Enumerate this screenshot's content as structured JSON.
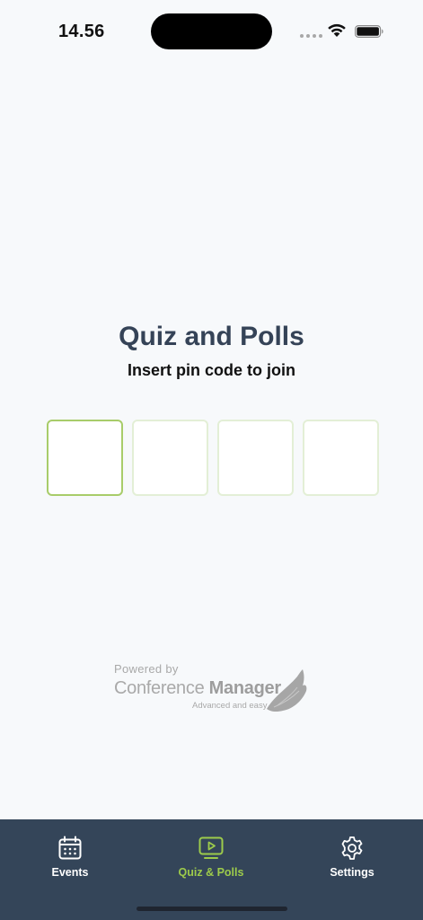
{
  "status_bar": {
    "time": "14.56"
  },
  "main": {
    "title": "Quiz and Polls",
    "subtitle": "Insert pin code to join",
    "pin_digits": [
      "",
      "",
      "",
      ""
    ]
  },
  "branding": {
    "powered_by": "Powered by",
    "brand_light": "Conference ",
    "brand_bold": "Manager",
    "tagline": "Advanced and easy"
  },
  "tab_bar": {
    "tabs": [
      {
        "label": "Events",
        "icon": "calendar-icon",
        "active": false
      },
      {
        "label": "Quiz & Polls",
        "icon": "monitor-play-icon",
        "active": true
      },
      {
        "label": "Settings",
        "icon": "gear-icon",
        "active": false
      }
    ]
  },
  "colors": {
    "accent": "#9dcb4b",
    "tab_bar_bg": "#344559",
    "title": "#354357",
    "background": "#f7f9fb"
  }
}
